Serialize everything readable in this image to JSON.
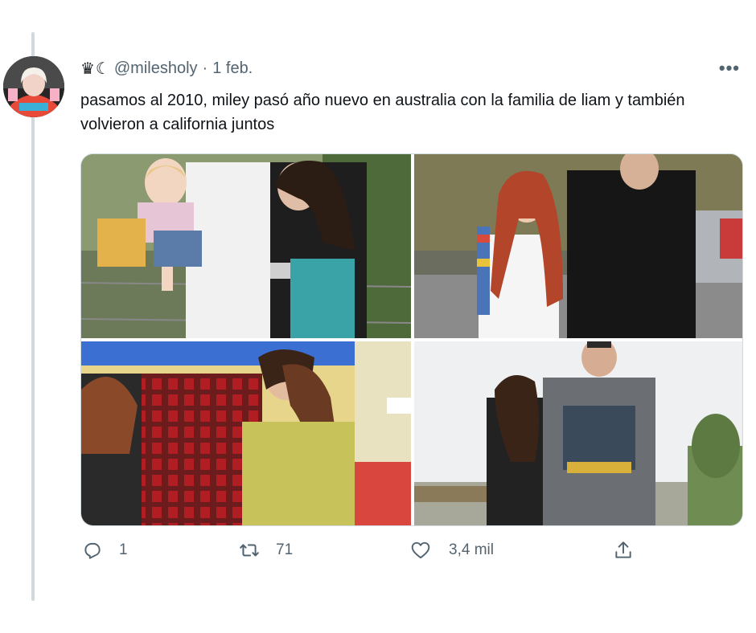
{
  "tweet": {
    "author_prefix": "♛☾",
    "handle": "@milesholy",
    "separator": "·",
    "date": "1 feb.",
    "more_label": "•••",
    "text": "pasamos al 2010, miley pasó año nuevo en australia con la familia de liam y también volvieron a california juntos"
  },
  "actions": {
    "reply_count": "1",
    "retweet_count": "71",
    "like_count": "3,4 mil"
  },
  "colors": {
    "text_primary": "#0f1419",
    "text_secondary": "#536471",
    "border": "#cfd9de"
  },
  "icons": [
    "reply-icon",
    "retweet-icon",
    "like-icon",
    "share-icon",
    "more-icon"
  ]
}
